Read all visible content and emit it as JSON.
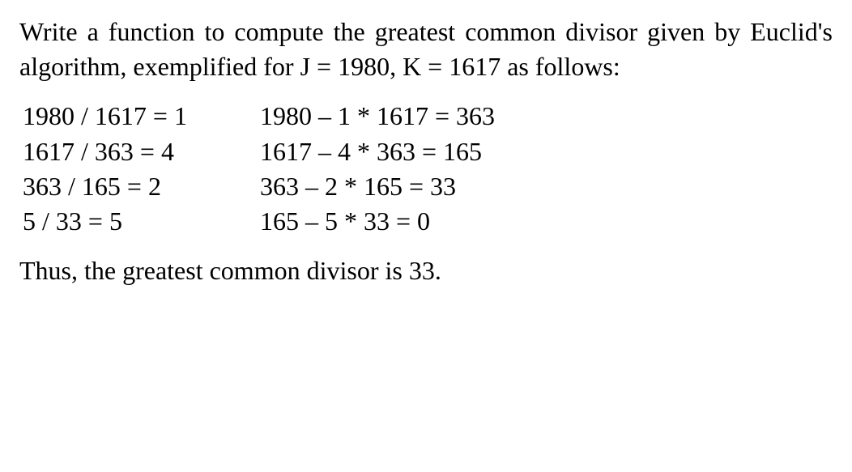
{
  "intro": "Write a function to compute the greatest common divisor given by Euclid's algorithm, exemplified for J = 1980, K = 1617 as follows:",
  "left_col": [
    "1980 / 1617 = 1",
    "1617 / 363 = 4",
    "363 / 165 = 2",
    "5 / 33 = 5"
  ],
  "right_col": [
    "1980 – 1 * 1617 = 363",
    "1617 – 4 * 363 = 165",
    "363 – 2 * 165 = 33",
    "165 – 5 * 33 = 0"
  ],
  "conclusion": "Thus, the greatest common divisor is 33."
}
